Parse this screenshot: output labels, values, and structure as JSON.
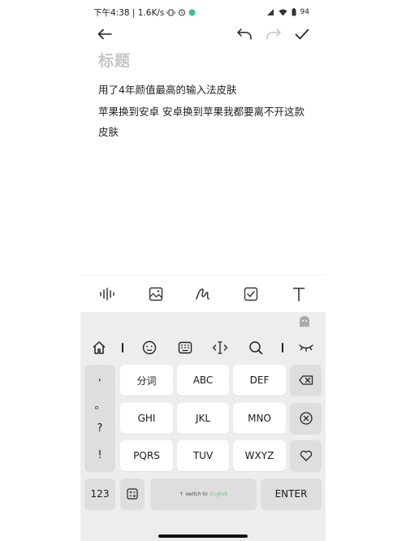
{
  "status_bar": {
    "time_and_speed": "下午4:38 | 1.6K/s",
    "battery": "94"
  },
  "toolbar": {
    "back_icon": "arrow-left-icon",
    "undo_icon": "undo-icon",
    "redo_icon": "redo-icon",
    "confirm_icon": "checkmark-icon"
  },
  "note": {
    "title_placeholder": "标题",
    "paragraphs": [
      "用了4年颜值最高的输入法皮肤",
      "苹果换到安卓 安卓换到苹果我都要离不开这款皮肤"
    ]
  },
  "editor_tools": [
    "audio-wave-icon",
    "image-icon",
    "handwriting-icon",
    "checkbox-icon",
    "text-format-icon"
  ],
  "keyboard": {
    "function_row": [
      "home-icon",
      "emoji-icon",
      "keyboard-icon",
      "cursor-icon",
      "search-icon",
      "collapse-icon"
    ],
    "punctuation": [
      ",",
      "。",
      "?",
      "!"
    ],
    "keys": {
      "fenci": "分词",
      "abc": "ABC",
      "def": "DEF",
      "ghi": "GHI",
      "jkl": "JKL",
      "mno": "MNO",
      "pqrs": "PQRS",
      "tuv": "TUV",
      "wxyz": "WXYZ",
      "num": "123",
      "enter": "ENTER",
      "space_hint": "switch to",
      "space_lang": "English",
      "space_arrow": "↑"
    }
  },
  "colors": {
    "accent_green": "#6cc27a",
    "keyboard_bg": "#ededed",
    "key_bg": "#ffffff",
    "dark_key_bg": "#dedede"
  }
}
